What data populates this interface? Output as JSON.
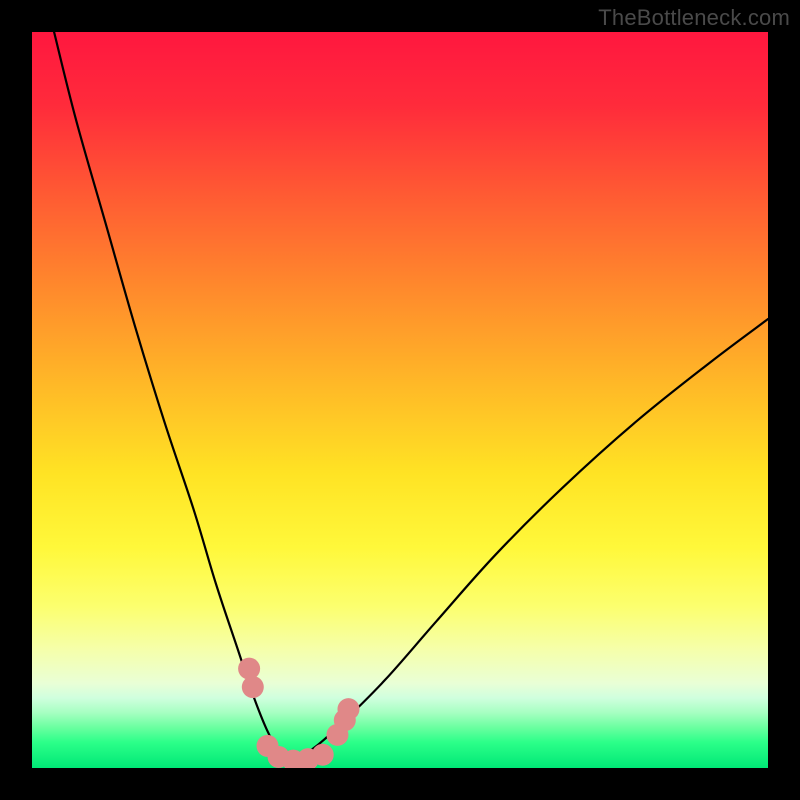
{
  "watermark": {
    "text": "TheBottleneck.com"
  },
  "colors": {
    "bg_black": "#000000",
    "marker_fill": "#e08888",
    "curve_stroke": "#000000",
    "gradient_stops": [
      {
        "offset": 0.0,
        "color": "#ff173f"
      },
      {
        "offset": 0.1,
        "color": "#ff2b3b"
      },
      {
        "offset": 0.22,
        "color": "#ff5a33"
      },
      {
        "offset": 0.35,
        "color": "#ff8a2c"
      },
      {
        "offset": 0.48,
        "color": "#ffb927"
      },
      {
        "offset": 0.6,
        "color": "#ffe324"
      },
      {
        "offset": 0.7,
        "color": "#fff83a"
      },
      {
        "offset": 0.78,
        "color": "#fcff6e"
      },
      {
        "offset": 0.84,
        "color": "#f5ffab"
      },
      {
        "offset": 0.885,
        "color": "#e9ffd6"
      },
      {
        "offset": 0.905,
        "color": "#cfffde"
      },
      {
        "offset": 0.925,
        "color": "#a6ffc1"
      },
      {
        "offset": 0.945,
        "color": "#6affa0"
      },
      {
        "offset": 0.965,
        "color": "#2cff89"
      },
      {
        "offset": 1.0,
        "color": "#00e876"
      }
    ]
  },
  "chart_data": {
    "type": "line",
    "title": "",
    "xlabel": "",
    "ylabel": "",
    "xlim": [
      0,
      100
    ],
    "ylim": [
      0,
      100
    ],
    "grid": false,
    "legend": false,
    "note": "V-shaped bottleneck curve over red→yellow→green heat gradient. Minimum near x≈35. Background green at bottom indicates optimal (low bottleneck) zone.",
    "series": [
      {
        "name": "left-branch",
        "x": [
          3,
          6,
          10,
          14,
          18,
          22,
          25,
          28,
          30,
          32,
          33.5,
          35
        ],
        "values": [
          100,
          88,
          74,
          60,
          47,
          35,
          25,
          16,
          10,
          5,
          2.5,
          1
        ]
      },
      {
        "name": "right-branch",
        "x": [
          35,
          38,
          42,
          48,
          55,
          63,
          72,
          82,
          92,
          100
        ],
        "values": [
          1,
          2.5,
          6,
          12,
          20,
          29,
          38,
          47,
          55,
          61
        ]
      }
    ],
    "markers": {
      "name": "sample-points",
      "points": [
        {
          "x": 29.5,
          "y": 13.5
        },
        {
          "x": 30.0,
          "y": 11.0
        },
        {
          "x": 32.0,
          "y": 3.0
        },
        {
          "x": 33.5,
          "y": 1.5
        },
        {
          "x": 35.5,
          "y": 1.0
        },
        {
          "x": 37.5,
          "y": 1.2
        },
        {
          "x": 39.5,
          "y": 1.8
        },
        {
          "x": 41.5,
          "y": 4.5
        },
        {
          "x": 42.5,
          "y": 6.5
        },
        {
          "x": 43.0,
          "y": 8.0
        }
      ]
    }
  }
}
